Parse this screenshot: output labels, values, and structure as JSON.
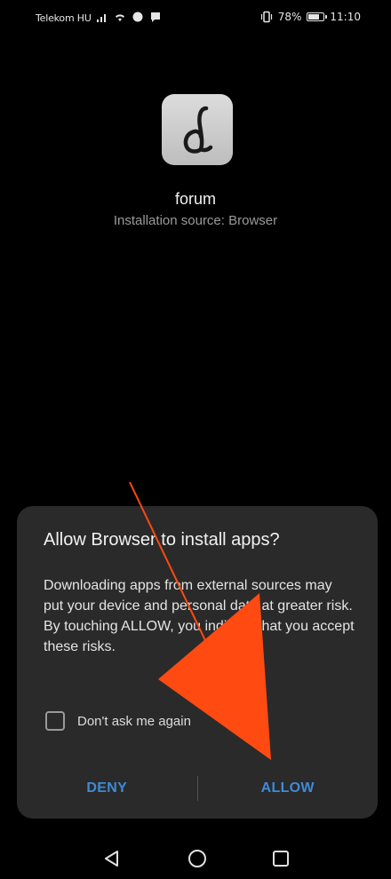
{
  "status_bar": {
    "carrier": "Telekom HU",
    "battery_percent": "78%",
    "battery_level": 0.78,
    "time": "11:10"
  },
  "app": {
    "name": "forum",
    "install_source": "Installation source: Browser",
    "icon": "app-logo-letter-d"
  },
  "dialog": {
    "title": "Allow Browser to install apps?",
    "message": "Downloading apps from external sources may put your device and personal data at greater risk. By touching ALLOW, you indicate that you accept these risks.",
    "checkbox_label": "Don't ask me again",
    "deny_label": "DENY",
    "allow_label": "ALLOW"
  },
  "colors": {
    "button": "#3f8ad8",
    "annotation_arrow": "#ff4a12",
    "dialog_bg": "#2a2a2a"
  },
  "nav": {
    "back_icon": "triangle-back-icon",
    "home_icon": "circle-home-icon",
    "recent_icon": "square-recents-icon"
  }
}
